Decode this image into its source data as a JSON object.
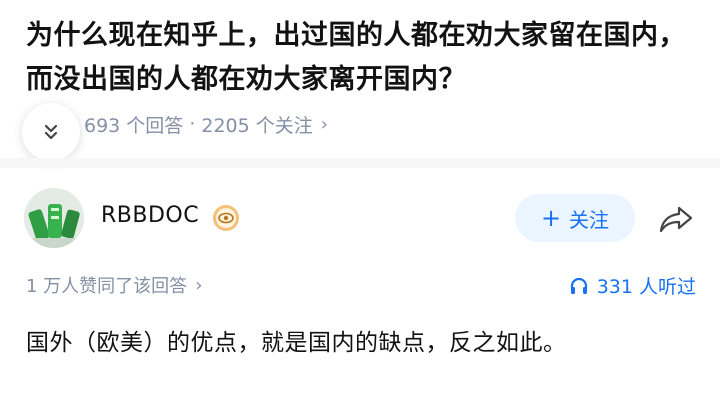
{
  "question": {
    "title": "为什么现在知乎上，出过国的人都在劝大家留在国内，而没出国的人都在劝大家离开国内？",
    "answer_count": "693 个回答",
    "separator": "·",
    "follower_count": "2205 个关注",
    "meta_chevron": "›"
  },
  "author": {
    "name": "RBBDOC",
    "follow_label": "关注",
    "follow_plus": "+"
  },
  "stats": {
    "agree_text": "1 万人赞同了该回答",
    "agree_chevron": "›",
    "listen_text": "331 人听过"
  },
  "answer": {
    "text": "国外（欧美）的优点，就是国内的缺点，反之如此。"
  },
  "colors": {
    "accent": "#1772f6",
    "follow_bg": "#ebf5ff",
    "meta_gray": "#8590a6",
    "text_main": "#121212"
  },
  "icons": {
    "collapse": "chevron-double-down-icon",
    "badge": "eye-badge-icon",
    "share": "share-arrow-icon",
    "listen": "headphones-icon"
  }
}
